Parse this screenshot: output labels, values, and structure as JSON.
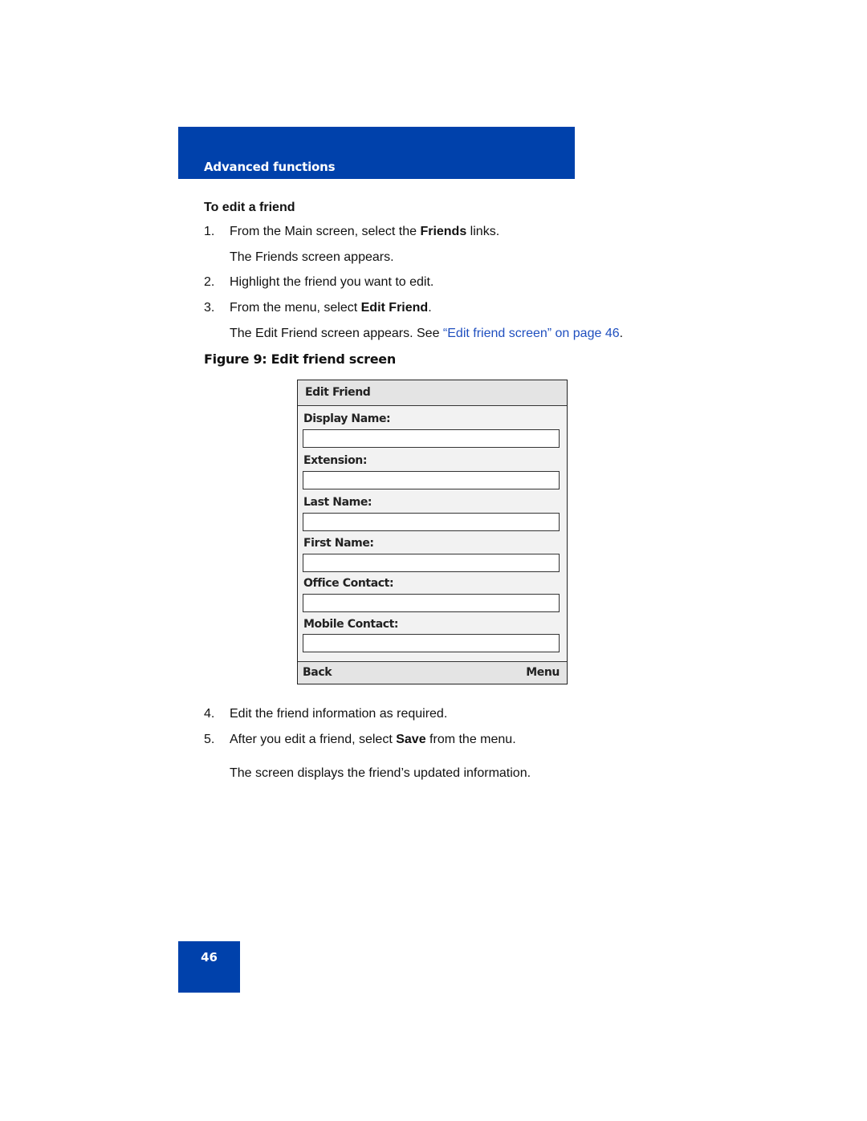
{
  "header": {
    "section_title": "Advanced functions",
    "color": "#0041ab"
  },
  "procedure": {
    "title": "To edit a friend",
    "steps": [
      {
        "num": "1.",
        "pre": "From the Main screen, select the ",
        "bold": "Friends",
        "post": " links.",
        "result": "The Friends screen appears."
      },
      {
        "num": "2.",
        "text": "Highlight the friend you want to edit."
      },
      {
        "num": "3.",
        "pre": "From the menu, select ",
        "bold": "Edit Friend",
        "post": ".",
        "result_pre": "The Edit Friend screen appears. See ",
        "result_link": "“Edit friend screen” on page 46",
        "result_post": "."
      },
      {
        "num": "4.",
        "text": "Edit the friend information as required."
      },
      {
        "num": "5.",
        "pre": "After you edit a friend, select ",
        "bold": "Save",
        "post": " from the menu.",
        "result": "The screen displays the friend’s updated information."
      }
    ]
  },
  "figure": {
    "caption": "Figure 9: Edit friend screen",
    "screen": {
      "title": "Edit Friend",
      "fields": [
        {
          "label": "Display Name:",
          "value": ""
        },
        {
          "label": "Extension:",
          "value": ""
        },
        {
          "label": "Last Name:",
          "value": ""
        },
        {
          "label": "First Name:",
          "value": ""
        },
        {
          "label": "Office Contact:",
          "value": ""
        },
        {
          "label": "Mobile Contact:",
          "value": ""
        }
      ],
      "softkey_left": "Back",
      "softkey_right": "Menu"
    }
  },
  "footer": {
    "page_number": "46"
  }
}
